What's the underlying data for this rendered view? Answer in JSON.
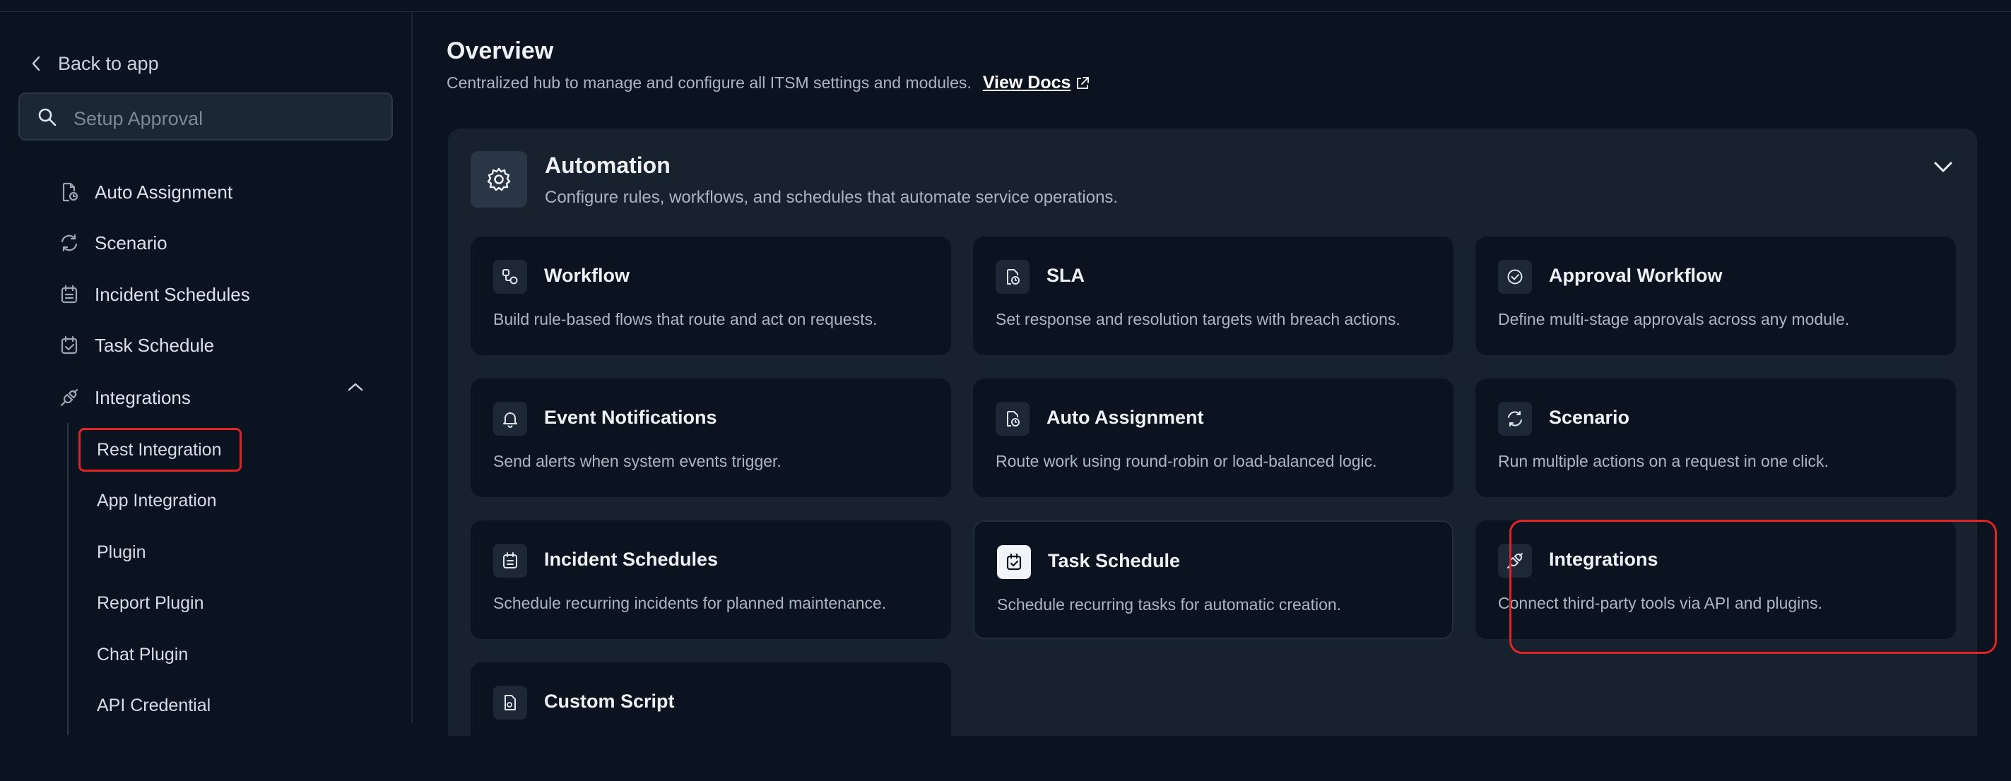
{
  "sidebar": {
    "back_label": "Back to app",
    "search_placeholder": "Setup Approval",
    "items": [
      {
        "label": "Auto Assignment"
      },
      {
        "label": "Scenario"
      },
      {
        "label": "Incident Schedules"
      },
      {
        "label": "Task Schedule"
      },
      {
        "label": "Integrations"
      }
    ],
    "sub_items": [
      {
        "label": "Rest Integration"
      },
      {
        "label": "App Integration"
      },
      {
        "label": "Plugin"
      },
      {
        "label": "Report Plugin"
      },
      {
        "label": "Chat Plugin"
      },
      {
        "label": "API Credential"
      }
    ]
  },
  "header": {
    "title": "Overview",
    "subtitle": "Centralized hub to manage and configure all ITSM settings and modules.",
    "docs_link": "View Docs"
  },
  "section": {
    "title": "Automation",
    "description": "Configure rules, workflows, and schedules that automate service operations.",
    "cards": [
      {
        "title": "Workflow",
        "description": "Build rule-based flows that route and act on requests.",
        "icon": "workflow-icon"
      },
      {
        "title": "SLA",
        "description": "Set response and resolution targets with breach actions.",
        "icon": "sla-icon"
      },
      {
        "title": "Approval Workflow",
        "description": "Define multi-stage approvals across any module.",
        "icon": "check-circle-icon"
      },
      {
        "title": "Event Notifications",
        "description": "Send alerts when system events trigger.",
        "icon": "bell-icon"
      },
      {
        "title": "Auto Assignment",
        "description": "Route work using round-robin or load-balanced logic.",
        "icon": "auto-assign-icon"
      },
      {
        "title": "Scenario",
        "description": "Run multiple actions on a request in one click.",
        "icon": "refresh-icon"
      },
      {
        "title": "Incident Schedules",
        "description": "Schedule recurring incidents for planned maintenance.",
        "icon": "calendar-icon"
      },
      {
        "title": "Task Schedule",
        "description": "Schedule recurring tasks for automatic creation.",
        "icon": "calendar-check-icon"
      },
      {
        "title": "Integrations",
        "description": "Connect third-party tools via API and plugins.",
        "icon": "plug-icon"
      },
      {
        "title": "Custom Script",
        "description": "",
        "icon": "script-icon"
      }
    ]
  },
  "colors": {
    "background": "#0b1320",
    "panel": "#18222f",
    "highlight": "#e02424"
  }
}
